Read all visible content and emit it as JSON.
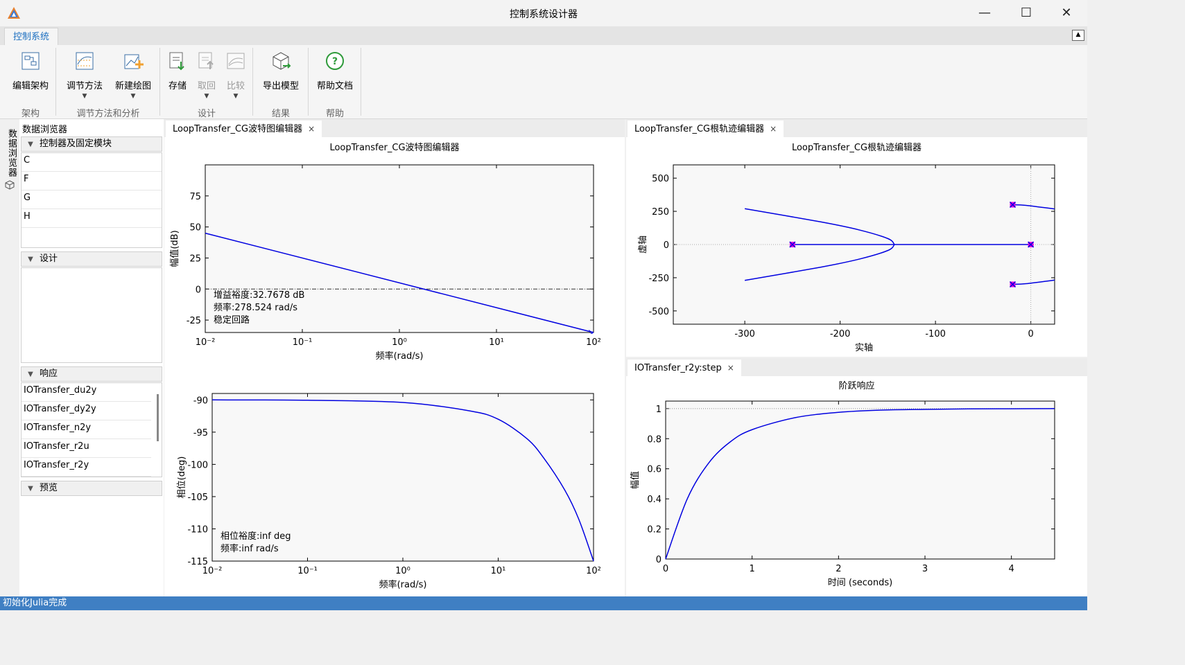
{
  "window": {
    "title": "控制系统设计器",
    "minimize": "—",
    "maximize": "☐",
    "close": "✕"
  },
  "ribbon_tab": "控制系统",
  "ribbon": {
    "buttons": {
      "edit_arch": "编辑架构",
      "tune_method": "调节方法",
      "new_plot": "新建绘图",
      "store": "存储",
      "retrieve": "取回",
      "compare": "比较",
      "export_model": "导出模型",
      "help_doc": "帮助文档"
    },
    "groups": {
      "arch": "架构",
      "tune": "调节方法和分析",
      "design": "设计",
      "result": "结果",
      "help": "帮助"
    }
  },
  "side_tab": "数据浏览器",
  "browser": {
    "title": "数据浏览器",
    "sections": {
      "controllers": "控制器及固定模块",
      "design": "设计",
      "responses": "响应",
      "preview": "预览"
    },
    "controllers": [
      "C",
      "F",
      "G",
      "H"
    ],
    "responses": [
      "IOTransfer_du2y",
      "IOTransfer_dy2y",
      "IOTransfer_n2y",
      "IOTransfer_r2u",
      "IOTransfer_r2y"
    ]
  },
  "tabs": {
    "bode": "LoopTransfer_CG波特图编辑器",
    "rlocus": "LoopTransfer_CG根轨迹编辑器",
    "step": "IOTransfer_r2y:step",
    "close": "×"
  },
  "bode": {
    "title": "LoopTransfer_CG波特图编辑器",
    "mag_ylabel": "幅值(dB)",
    "phase_ylabel": "相位(deg)",
    "xlabel": "频率(rad/s)",
    "gain_margin": "增益裕度:32.7678 dB",
    "gain_freq": "频率:278.524 rad/s",
    "stable": "稳定回路",
    "phase_margin": "相位裕度:inf deg",
    "phase_freq": "频率:inf rad/s"
  },
  "rlocus": {
    "title": "LoopTransfer_CG根轨迹编辑器",
    "xlabel": "实轴",
    "ylabel": "虚轴"
  },
  "step": {
    "title": "阶跃响应",
    "xlabel": "时间 (seconds)",
    "ylabel": "幅值"
  },
  "status": "初始化Julia完成",
  "chart_data": [
    {
      "type": "line",
      "title": "LoopTransfer_CG波特图编辑器",
      "xlabel": "频率(rad/s)",
      "ylabel": "幅值(dB)",
      "xscale": "log",
      "xlim": [
        0.01,
        100
      ],
      "ylim": [
        -35,
        100
      ],
      "x": [
        0.01,
        100
      ],
      "xticks": [
        0.01,
        0.1,
        1,
        10,
        100
      ],
      "yticks": [
        75,
        50,
        25,
        0,
        -25
      ],
      "series": [
        {
          "values": [
            45,
            -35
          ]
        }
      ],
      "annotations": [
        "增益裕度:32.7678 dB",
        "频率:278.524 rad/s",
        "稳定回路"
      ]
    },
    {
      "type": "line",
      "xlabel": "频率(rad/s)",
      "ylabel": "相位(deg)",
      "xscale": "log",
      "xlim": [
        0.01,
        100
      ],
      "ylim": [
        -115,
        -89
      ],
      "x": [
        0.01,
        0.1,
        1,
        5,
        10,
        20,
        30,
        50,
        70,
        100
      ],
      "xticks": [
        0.01,
        0.1,
        1,
        10,
        100
      ],
      "yticks": [
        -90,
        -95,
        -100,
        -105,
        -110,
        -115
      ],
      "series": [
        {
          "values": [
            -90,
            -90.05,
            -90.4,
            -91.7,
            -93,
            -96,
            -99,
            -104,
            -108.5,
            -115
          ]
        }
      ],
      "annotations": [
        "相位裕度:inf deg",
        "频率:inf rad/s"
      ]
    },
    {
      "type": "line",
      "title": "LoopTransfer_CG根轨迹编辑器",
      "xlabel": "实轴",
      "ylabel": "虚轴",
      "xlim": [
        -375,
        25
      ],
      "ylim": [
        -600,
        600
      ],
      "xticks": [
        -300,
        -200,
        -100,
        0
      ],
      "yticks": [
        500,
        250,
        0,
        -250,
        -500
      ],
      "series": [
        {
          "points": [
            [
              -250,
              0
            ],
            [
              -143,
              0
            ]
          ]
        },
        {
          "points": [
            [
              0,
              0
            ],
            [
              -143,
              0
            ]
          ]
        },
        {
          "points": [
            [
              -143,
              0
            ],
            [
              -150,
              45
            ],
            [
              -180,
              110
            ],
            [
              -220,
              170
            ],
            [
              -300,
              270
            ]
          ]
        },
        {
          "points": [
            [
              -143,
              0
            ],
            [
              -150,
              -45
            ],
            [
              -180,
              -110
            ],
            [
              -220,
              -170
            ],
            [
              -300,
              -270
            ]
          ]
        },
        {
          "points": [
            [
              -19,
              300
            ],
            [
              -5,
              295
            ],
            [
              25,
              268
            ]
          ]
        },
        {
          "points": [
            [
              -19,
              -300
            ],
            [
              -5,
              -295
            ],
            [
              25,
              -268
            ]
          ]
        }
      ],
      "poles": [
        [
          -250,
          0
        ],
        [
          0,
          0
        ],
        [
          -19,
          300
        ],
        [
          -19,
          -300
        ]
      ]
    },
    {
      "type": "line",
      "title": "阶跃响应",
      "xlabel": "时间 (seconds)",
      "ylabel": "幅值",
      "xlim": [
        0,
        4.5
      ],
      "ylim": [
        0,
        1.05
      ],
      "xticks": [
        0,
        1,
        2,
        3,
        4
      ],
      "yticks": [
        1,
        0.8,
        0.6,
        0.4,
        0.2,
        0
      ],
      "x": [
        0,
        0.25,
        0.5,
        0.75,
        1,
        1.5,
        2,
        2.5,
        3,
        3.5,
        4,
        4.5
      ],
      "series": [
        {
          "values": [
            0,
            0.4,
            0.64,
            0.78,
            0.86,
            0.94,
            0.975,
            0.99,
            0.995,
            0.998,
            0.999,
            1.0
          ]
        }
      ]
    }
  ]
}
